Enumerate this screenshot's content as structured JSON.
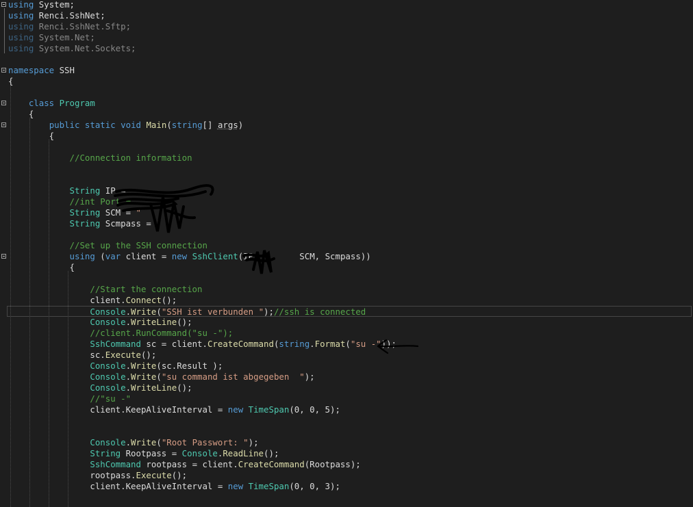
{
  "lines": [
    {
      "id": "l1",
      "tokens": [
        {
          "t": "using",
          "c": "kw"
        },
        {
          "t": " System;"
        }
      ]
    },
    {
      "id": "l2",
      "tokens": [
        {
          "t": "using",
          "c": "kw"
        },
        {
          "t": " Renci.SshNet;"
        }
      ]
    },
    {
      "id": "l3",
      "dim": true,
      "tokens": [
        {
          "t": "using",
          "c": "kw"
        },
        {
          "t": " Renci.SshNet.Sftp;"
        }
      ]
    },
    {
      "id": "l4",
      "dim": true,
      "tokens": [
        {
          "t": "using",
          "c": "kw"
        },
        {
          "t": " System.Net;"
        }
      ]
    },
    {
      "id": "l5",
      "dim": true,
      "tokens": [
        {
          "t": "using",
          "c": "kw"
        },
        {
          "t": " System.Net.Sockets;"
        }
      ]
    },
    {
      "id": "l6",
      "tokens": []
    },
    {
      "id": "l7",
      "tokens": [
        {
          "t": "namespace",
          "c": "kw"
        },
        {
          "t": " SSH"
        }
      ]
    },
    {
      "id": "l8",
      "tokens": [
        {
          "t": "{"
        }
      ]
    },
    {
      "id": "l9",
      "tokens": []
    },
    {
      "id": "l10",
      "tokens": [
        {
          "t": "    "
        },
        {
          "t": "class",
          "c": "kw"
        },
        {
          "t": " "
        },
        {
          "t": "Program",
          "c": "ty"
        }
      ]
    },
    {
      "id": "l11",
      "tokens": [
        {
          "t": "    {"
        }
      ]
    },
    {
      "id": "l12",
      "tokens": [
        {
          "t": "        "
        },
        {
          "t": "public",
          "c": "kw"
        },
        {
          "t": " "
        },
        {
          "t": "static",
          "c": "kw"
        },
        {
          "t": " "
        },
        {
          "t": "void",
          "c": "kw"
        },
        {
          "t": " "
        },
        {
          "t": "Main",
          "c": "fn"
        },
        {
          "t": "("
        },
        {
          "t": "string",
          "c": "kw"
        },
        {
          "t": "[] "
        },
        {
          "t": "args",
          "c": "squiggle"
        },
        {
          "t": ")"
        }
      ]
    },
    {
      "id": "l13",
      "tokens": [
        {
          "t": "        {"
        }
      ]
    },
    {
      "id": "l14",
      "tokens": []
    },
    {
      "id": "l15",
      "tokens": [
        {
          "t": "            "
        },
        {
          "t": "//Connection information",
          "c": "cm"
        }
      ]
    },
    {
      "id": "l16",
      "tokens": []
    },
    {
      "id": "l17",
      "tokens": []
    },
    {
      "id": "l18",
      "tokens": [
        {
          "t": "            "
        },
        {
          "t": "String",
          "c": "ty"
        },
        {
          "t": " IP = "
        }
      ]
    },
    {
      "id": "l19",
      "tokens": [
        {
          "t": "            "
        },
        {
          "t": "//int Port =",
          "c": "cm"
        }
      ]
    },
    {
      "id": "l20",
      "tokens": [
        {
          "t": "            "
        },
        {
          "t": "String",
          "c": "ty"
        },
        {
          "t": " SCM = "
        },
        {
          "t": "\"",
          "c": "st"
        }
      ]
    },
    {
      "id": "l21",
      "tokens": [
        {
          "t": "            "
        },
        {
          "t": "String",
          "c": "ty"
        },
        {
          "t": " Scmpass = "
        },
        {
          "t": "\"",
          "c": "st"
        }
      ]
    },
    {
      "id": "l22",
      "tokens": []
    },
    {
      "id": "l23",
      "tokens": [
        {
          "t": "            "
        },
        {
          "t": "//Set up the SSH connection",
          "c": "cm"
        }
      ]
    },
    {
      "id": "l24",
      "tokens": [
        {
          "t": "            "
        },
        {
          "t": "using",
          "c": "kw"
        },
        {
          "t": " ("
        },
        {
          "t": "var",
          "c": "kw"
        },
        {
          "t": " client = "
        },
        {
          "t": "new",
          "c": "kw"
        },
        {
          "t": " "
        },
        {
          "t": "SshClient",
          "c": "ty"
        },
        {
          "t": "(IP,        SCM, Scmpass))"
        }
      ]
    },
    {
      "id": "l25",
      "tokens": [
        {
          "t": "            {"
        }
      ]
    },
    {
      "id": "l26",
      "tokens": []
    },
    {
      "id": "l27",
      "tokens": [
        {
          "t": "                "
        },
        {
          "t": "//Start the connection",
          "c": "cm"
        }
      ]
    },
    {
      "id": "l28",
      "tokens": [
        {
          "t": "                client."
        },
        {
          "t": "Connect",
          "c": "fn"
        },
        {
          "t": "();"
        }
      ]
    },
    {
      "id": "l29",
      "current": true,
      "tokens": [
        {
          "t": "                "
        },
        {
          "t": "Console",
          "c": "ty"
        },
        {
          "t": "."
        },
        {
          "t": "Write",
          "c": "fn"
        },
        {
          "t": "("
        },
        {
          "t": "\"SSH ist verbunden \"",
          "c": "st"
        },
        {
          "t": ");"
        },
        {
          "t": "//ssh is connected",
          "c": "cm"
        }
      ]
    },
    {
      "id": "l30",
      "tokens": [
        {
          "t": "                "
        },
        {
          "t": "Console",
          "c": "ty"
        },
        {
          "t": "."
        },
        {
          "t": "WriteLine",
          "c": "fn"
        },
        {
          "t": "();"
        }
      ]
    },
    {
      "id": "l31",
      "tokens": [
        {
          "t": "                "
        },
        {
          "t": "//client.RunCommand(\"su -\");",
          "c": "cm"
        }
      ]
    },
    {
      "id": "l32",
      "tokens": [
        {
          "t": "                "
        },
        {
          "t": "SshCommand",
          "c": "ty"
        },
        {
          "t": " sc = client."
        },
        {
          "t": "CreateCommand",
          "c": "fn"
        },
        {
          "t": "("
        },
        {
          "t": "string",
          "c": "kw"
        },
        {
          "t": "."
        },
        {
          "t": "Format",
          "c": "fn"
        },
        {
          "t": "("
        },
        {
          "t": "\"su -\"",
          "c": "st"
        },
        {
          "t": "));"
        }
      ]
    },
    {
      "id": "l33",
      "tokens": [
        {
          "t": "                sc."
        },
        {
          "t": "Execute",
          "c": "fn"
        },
        {
          "t": "();"
        }
      ]
    },
    {
      "id": "l34",
      "tokens": [
        {
          "t": "                "
        },
        {
          "t": "Console",
          "c": "ty"
        },
        {
          "t": "."
        },
        {
          "t": "Write",
          "c": "fn"
        },
        {
          "t": "(sc.Result );"
        }
      ]
    },
    {
      "id": "l35",
      "tokens": [
        {
          "t": "                "
        },
        {
          "t": "Console",
          "c": "ty"
        },
        {
          "t": "."
        },
        {
          "t": "Write",
          "c": "fn"
        },
        {
          "t": "("
        },
        {
          "t": "\"su command ist abgegeben  \"",
          "c": "st"
        },
        {
          "t": ");"
        }
      ]
    },
    {
      "id": "l36",
      "tokens": [
        {
          "t": "                "
        },
        {
          "t": "Console",
          "c": "ty"
        },
        {
          "t": "."
        },
        {
          "t": "WriteLine",
          "c": "fn"
        },
        {
          "t": "();"
        }
      ]
    },
    {
      "id": "l37",
      "tokens": [
        {
          "t": "                "
        },
        {
          "t": "//\"su -\"",
          "c": "cm"
        }
      ]
    },
    {
      "id": "l38",
      "tokens": [
        {
          "t": "                client.KeepAliveInterval = "
        },
        {
          "t": "new",
          "c": "kw"
        },
        {
          "t": " "
        },
        {
          "t": "TimeSpan",
          "c": "ty"
        },
        {
          "t": "(0, 0, 5);"
        }
      ]
    },
    {
      "id": "l39",
      "tokens": []
    },
    {
      "id": "l40",
      "tokens": []
    },
    {
      "id": "l41",
      "tokens": [
        {
          "t": "                "
        },
        {
          "t": "Console",
          "c": "ty"
        },
        {
          "t": "."
        },
        {
          "t": "Write",
          "c": "fn"
        },
        {
          "t": "("
        },
        {
          "t": "\"Root Passwort: \"",
          "c": "st"
        },
        {
          "t": ");"
        }
      ]
    },
    {
      "id": "l42",
      "tokens": [
        {
          "t": "                "
        },
        {
          "t": "String",
          "c": "ty"
        },
        {
          "t": " Rootpass = "
        },
        {
          "t": "Console",
          "c": "ty"
        },
        {
          "t": "."
        },
        {
          "t": "ReadLine",
          "c": "fn"
        },
        {
          "t": "();"
        }
      ]
    },
    {
      "id": "l43",
      "tokens": [
        {
          "t": "                "
        },
        {
          "t": "SshCommand",
          "c": "ty"
        },
        {
          "t": " rootpass = client."
        },
        {
          "t": "CreateCommand",
          "c": "fn"
        },
        {
          "t": "(Rootpass);"
        }
      ]
    },
    {
      "id": "l44",
      "tokens": [
        {
          "t": "                rootpass."
        },
        {
          "t": "Execute",
          "c": "fn"
        },
        {
          "t": "();"
        }
      ]
    },
    {
      "id": "l45",
      "tokens": [
        {
          "t": "                client.KeepAliveInterval = "
        },
        {
          "t": "new",
          "c": "kw"
        },
        {
          "t": " "
        },
        {
          "t": "TimeSpan",
          "c": "ty"
        },
        {
          "t": "(0, 0, 3);"
        }
      ]
    }
  ],
  "icons": {
    "fold": "collapse-box-icon",
    "redaction": "redaction-scribble",
    "arrow": "hand-drawn-arrow-icon"
  },
  "colors": {
    "background": "#1e1e1e",
    "keyword": "#569cd6",
    "type": "#4ec9b0",
    "comment": "#57a64a",
    "string": "#d69d85",
    "method": "#dcdcaa",
    "text": "#dcdcdc"
  }
}
